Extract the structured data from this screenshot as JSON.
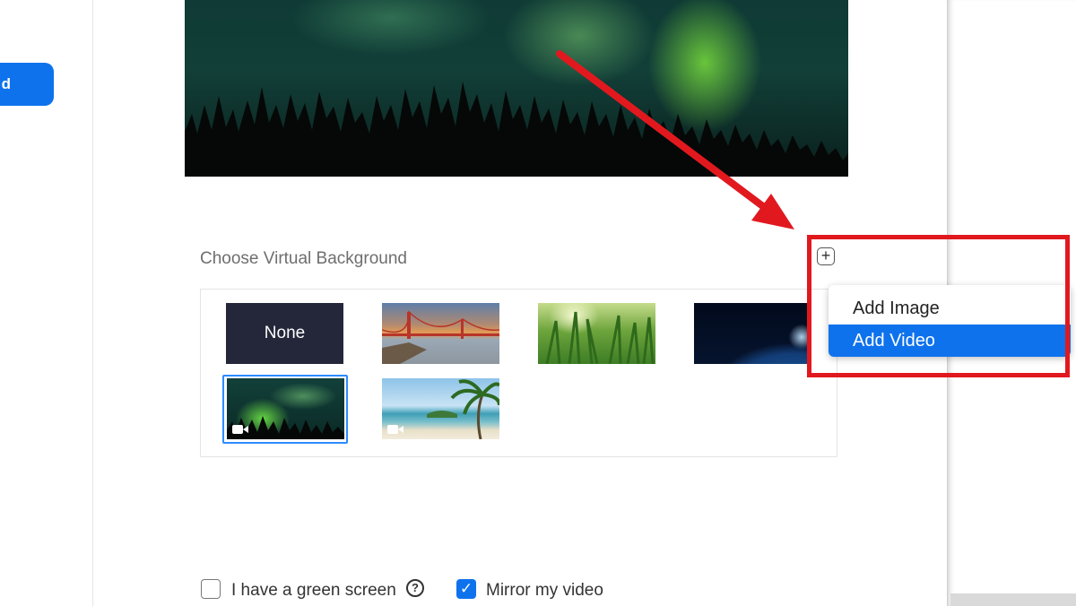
{
  "sidebar": {
    "active_item_label": "d"
  },
  "virtual_background": {
    "section_title": "Choose Virtual Background",
    "add_button_glyph": "+",
    "thumbnails": [
      {
        "label": "None",
        "kind": "none"
      },
      {
        "label": "",
        "kind": "image",
        "icon": "golden-gate-bridge"
      },
      {
        "label": "",
        "kind": "image",
        "icon": "grass"
      },
      {
        "label": "",
        "kind": "image",
        "icon": "earth-from-space"
      },
      {
        "label": "",
        "kind": "video",
        "icon": "aurora",
        "selected": true
      },
      {
        "label": "",
        "kind": "video",
        "icon": "beach-palm"
      }
    ]
  },
  "add_menu": {
    "items": [
      {
        "label": "Add Image",
        "highlighted": false
      },
      {
        "label": "Add Video",
        "highlighted": true
      }
    ]
  },
  "options": {
    "green_screen_label": "I have a green screen",
    "green_screen_checked": false,
    "help_glyph": "?",
    "mirror_label": "Mirror my video",
    "mirror_checked": true,
    "check_glyph": "✓"
  },
  "colors": {
    "accent": "#0e72ed",
    "selection": "#2d8cff",
    "annotation": "#e1191f"
  }
}
